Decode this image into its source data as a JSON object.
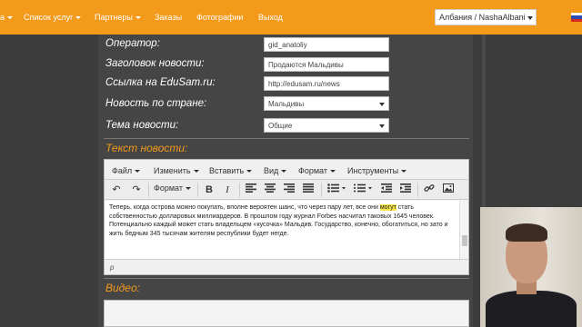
{
  "nav": {
    "items": [
      {
        "label": "а",
        "caret": true
      },
      {
        "label": "Список услуг",
        "caret": true
      },
      {
        "label": "Партнеры",
        "caret": true
      },
      {
        "label": "Заказы",
        "caret": false
      },
      {
        "label": "Фотографии",
        "caret": false
      },
      {
        "label": "Выход",
        "caret": false
      }
    ],
    "country_select": "Албания / NashaAlbani",
    "colors": {
      "bar": "#f39a1b"
    }
  },
  "form": {
    "operator_label": "Оператор:",
    "operator_value": "gid_anatoliy",
    "title_label": "Заголовок новости:",
    "title_value": "Продаются Мальдивы",
    "link_label": "Ссылка на EduSam.ru:",
    "link_value": "http://edusam.ru/news",
    "country_label": "Новость по стране:",
    "country_value": "Мальдивы",
    "topic_label": "Тема новости:",
    "topic_value": "Общие"
  },
  "text_section": {
    "heading": "Текст новости:"
  },
  "editor": {
    "menu": [
      "Файл",
      "Изменить",
      "Вставить",
      "Вид",
      "Формат",
      "Инструменты"
    ],
    "toolbar": {
      "undo_icon": "undo-icon",
      "redo_icon": "redo-icon",
      "format_label": "Формат",
      "bold_icon": "B",
      "italic_icon": "I"
    },
    "body_text": "Теперь, когда острова можно покупать, вполне вероятен шанс, что через пару лет, все они могут стать собственностью долларовых миллиардеров. В прошлом году журнал Forbes насчитал таковых 1645 человек. Потенциально каждый может стать владельцем «кусочка» Мальдив. Государство, конечно, обогатиться, но зато и жить бедным 345 тысячам жителям республики будет негде.",
    "status_path": "p"
  },
  "video_section": {
    "heading": "Видео:"
  }
}
